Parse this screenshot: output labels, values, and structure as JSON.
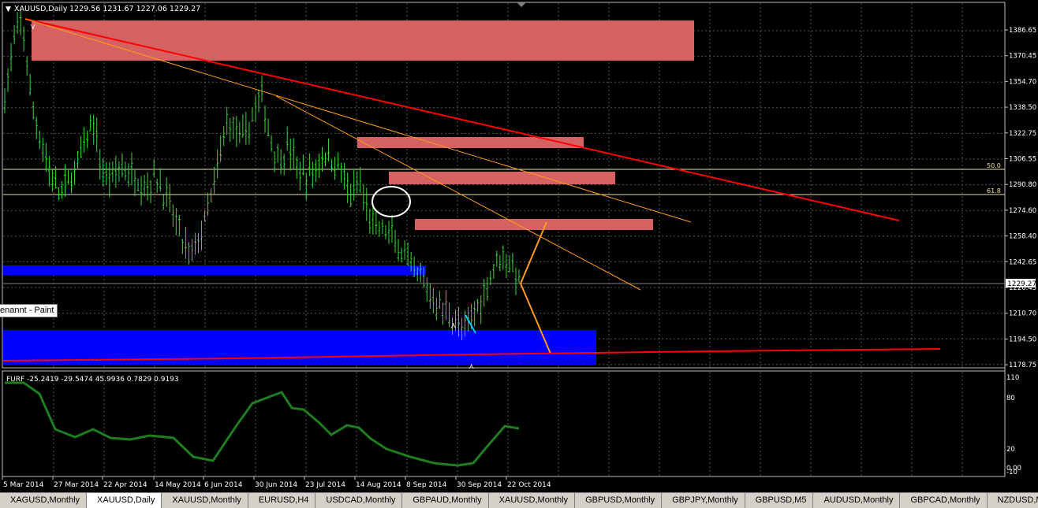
{
  "main_chart": {
    "symbol_label": "XAUUSD,Daily",
    "ohlc": "1229.56 1231.67 1227.06 1229.27",
    "current_price": "1229.27",
    "price_ticks": [
      "1386.65",
      "1370.45",
      "1354.70",
      "1338.50",
      "1322.75",
      "1306.55",
      "1290.80",
      "1274.60",
      "1258.40",
      "1242.65",
      "1226.45",
      "1210.70",
      "1194.50",
      "1178.75"
    ],
    "fib_labels": [
      "50.0",
      "61.8"
    ]
  },
  "indicator": {
    "label": "FURF -25.2419 -29.5474 45.9936 0.7829 0.9193",
    "ticks": [
      "110",
      "80",
      "20",
      "0.00",
      "-10"
    ]
  },
  "date_labels": [
    "5 Mar 2014",
    "27 Mar 2014",
    "22 Apr 2014",
    "14 May 2014",
    "6 Jun 2014",
    "30 Jun 2014",
    "23 Jul 2014",
    "14 Aug 2014",
    "8 Sep 2014",
    "30 Sep 2014",
    "22 Oct 2014"
  ],
  "tooltip": "enannt - Paint",
  "tabs": [
    "XAGUSD,Monthly",
    "XAUUSD,Daily",
    "XAUUSD,Monthly",
    "EURUSD,H4",
    "USDCAD,Monthly",
    "GBPAUD,Monthly",
    "XAUUSD,Monthly",
    "GBPUSD,Monthly",
    "GBPJPY,Monthly",
    "GBPUSD,M5",
    "AUDUSD,Monthly",
    "GBPCAD,Monthly",
    "NZDUSD,Monthly"
  ],
  "active_tab": 1,
  "colors": {
    "candles": "#3dd63d",
    "resistance_zone": "#e06666",
    "support_zone": "#0000ff",
    "trendline_main": "#ff0000",
    "trendline_thin": "#ff9a1a",
    "furf_line": "#1e7d1e",
    "grid": "#5a5a5a"
  },
  "price_series": [
    1345,
    1378,
    1392,
    1340,
    1320,
    1300,
    1285,
    1290,
    1300,
    1315,
    1330,
    1298,
    1295,
    1302,
    1298,
    1295,
    1290,
    1296,
    1285,
    1272,
    1255,
    1246,
    1258,
    1275,
    1300,
    1330,
    1325,
    1318,
    1335,
    1345,
    1318,
    1305,
    1315,
    1300,
    1295,
    1300,
    1310,
    1305,
    1300,
    1282,
    1292,
    1272,
    1262,
    1262,
    1255,
    1247,
    1235,
    1232,
    1222,
    1215,
    1212,
    1205,
    1198,
    1212,
    1222,
    1238,
    1248,
    1242,
    1230
  ]
}
